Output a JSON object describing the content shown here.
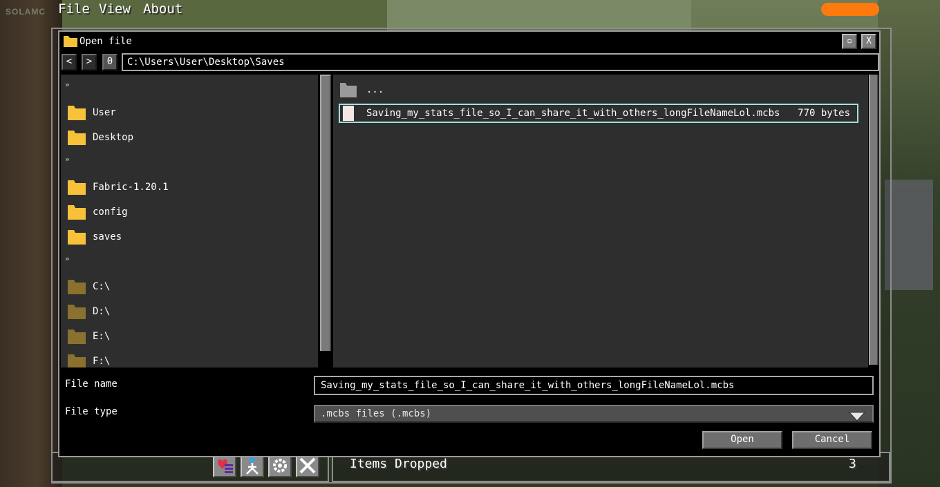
{
  "brand": "SOLAMC",
  "menu": {
    "file": "File",
    "view": "View",
    "about": "About"
  },
  "colors": {
    "accent": "#ff7a0d",
    "selection": "#9fe3e3",
    "folder_user": "#f7c23a",
    "folder_drive": "#8b7130"
  },
  "dialog": {
    "title": "Open file",
    "maximize_glyph": "▫",
    "close_glyph": "X",
    "nav": {
      "back": "<",
      "forward": ">",
      "edit": "0"
    },
    "path": "C:\\Users\\User\\Desktop\\Saves"
  },
  "sidebar": {
    "sep": "»",
    "group1": [
      "User",
      "Desktop"
    ],
    "group2": [
      "Fabric-1.20.1",
      "config",
      "saves"
    ],
    "drives": [
      "C:\\",
      "D:\\",
      "E:\\",
      "F:\\"
    ]
  },
  "files": [
    {
      "name": "...",
      "size": "",
      "type": "parent-folder"
    },
    {
      "name": "Saving_my_stats_file_so_I_can_share_it_with_others_longFileNameLol.mcbs",
      "size": "770 bytes",
      "type": "file"
    }
  ],
  "form": {
    "file_name_label": "File name",
    "file_name_value": "Saving_my_stats_file_so_I_can_share_it_with_others_longFileNameLol.mcbs",
    "file_type_label": "File type",
    "file_type_value": ".mcbs files (.mcbs)",
    "open_label": "Open",
    "cancel_label": "Cancel"
  },
  "bottom": {
    "items_dropped_label": "Items Dropped",
    "items_dropped_value": "3"
  },
  "toolbar_icons": [
    "heart-list-icon",
    "player-pin-icon",
    "gear-icon",
    "crossed-tools-icon"
  ]
}
